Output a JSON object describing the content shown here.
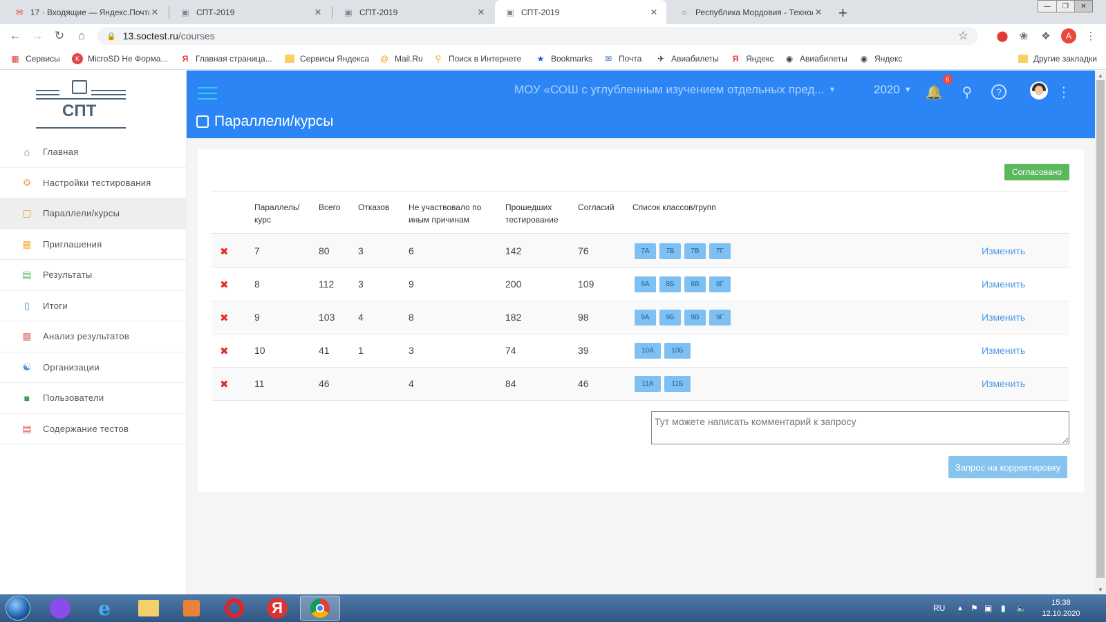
{
  "browser": {
    "tabs": [
      {
        "title": "17 · Входящие — Яндекс.Почта",
        "icon": "yandex-mail-icon"
      },
      {
        "title": "СПТ-2019",
        "icon": "spt-icon"
      },
      {
        "title": "СПТ-2019",
        "icon": "spt-icon"
      },
      {
        "title": "СПТ-2019",
        "icon": "spt-icon",
        "active": true
      },
      {
        "title": "Республика Мордовия - Технол",
        "icon": "tehnol-icon"
      }
    ],
    "url_host": "13.soctest.ru",
    "url_path": "/courses",
    "profile_initial": "A",
    "bookmarks": [
      {
        "label": "Сервисы",
        "icon": "apps-grid-icon"
      },
      {
        "label": "MicroSD Не Форма...",
        "icon": "red-bookmark-icon"
      },
      {
        "label": "Главная страница...",
        "icon": "yandex-icon"
      },
      {
        "label": "Сервисы Яндекса",
        "icon": "folder-icon"
      },
      {
        "label": "Mail.Ru",
        "icon": "mailru-icon"
      },
      {
        "label": "Поиск в Интернете",
        "icon": "search-icon"
      },
      {
        "label": "Bookmarks",
        "icon": "star-icon"
      },
      {
        "label": "Почта",
        "icon": "mail-icon"
      },
      {
        "label": "Авиабилеты",
        "icon": "plane-icon"
      },
      {
        "label": "Яндекс",
        "icon": "yandex-icon"
      },
      {
        "label": "Авиабилеты",
        "icon": "globe-icon"
      },
      {
        "label": "Яндекс",
        "icon": "globe-icon"
      }
    ],
    "other_bookmarks": "Другие закладки"
  },
  "app": {
    "logo_text": "СПТ",
    "org_name": "МОУ «СОШ с углубленным изучением отдельных пред...",
    "year": "2020",
    "notifications_count": "6",
    "page_title": "Параллели/курсы",
    "accent_color": "#2b85f5"
  },
  "sidebar": {
    "items": [
      {
        "label": "Главная",
        "icon": "home-icon",
        "color": "#8e44ad"
      },
      {
        "label": "Настройки тестирования",
        "icon": "settings-icon",
        "color": "#f0a05a"
      },
      {
        "label": "Параллели/курсы",
        "icon": "courses-icon",
        "color": "#f39c12",
        "selected": true
      },
      {
        "label": "Приглашения",
        "icon": "invite-icon",
        "color": "#f5b041"
      },
      {
        "label": "Результаты",
        "icon": "results-icon",
        "color": "#58b368"
      },
      {
        "label": "Итоги",
        "icon": "document-icon",
        "color": "#3f86d8"
      },
      {
        "label": "Анализ результатов",
        "icon": "chart-icon",
        "color": "#e07a7a"
      },
      {
        "label": "Организации",
        "icon": "org-icon",
        "color": "#4a90d9"
      },
      {
        "label": "Пользователи",
        "icon": "user-icon",
        "color": "#3aa655"
      },
      {
        "label": "Содержание тестов",
        "icon": "tests-icon",
        "color": "#d9534f"
      }
    ]
  },
  "main": {
    "status_button": "Согласовано",
    "columns": [
      "Параллель/ курс",
      "Всего",
      "Отказов",
      "Не участвовало по иным причинам",
      "Прошедших тестирование",
      "Согласий",
      "Список классов/групп"
    ],
    "rows": [
      {
        "course": "7",
        "total": "80",
        "refusals": "3",
        "other": "6",
        "passed": "142",
        "consents": "76",
        "classes": [
          "7А",
          "7Б",
          "7В",
          "7Г"
        ],
        "action": "Изменить"
      },
      {
        "course": "8",
        "total": "112",
        "refusals": "3",
        "other": "9",
        "passed": "200",
        "consents": "109",
        "classes": [
          "8А",
          "8Б",
          "8В",
          "8Г"
        ],
        "action": "Изменить"
      },
      {
        "course": "9",
        "total": "103",
        "refusals": "4",
        "other": "8",
        "passed": "182",
        "consents": "98",
        "classes": [
          "9А",
          "9Б",
          "9В",
          "9Г"
        ],
        "action": "Изменить"
      },
      {
        "course": "10",
        "total": "41",
        "refusals": "1",
        "other": "3",
        "passed": "74",
        "consents": "39",
        "classes": [
          "10А",
          "10Б"
        ],
        "action": "Изменить"
      },
      {
        "course": "11",
        "total": "46",
        "refusals": "",
        "other": "4",
        "passed": "84",
        "consents": "46",
        "classes": [
          "11А",
          "11Б"
        ],
        "action": "Изменить"
      }
    ],
    "comment_placeholder": "Тут можете написать комментарий к запросу",
    "request_button": "Запрос на корректировку"
  },
  "taskbar": {
    "language": "RU",
    "time": "15:38",
    "date": "12.10.2020"
  }
}
